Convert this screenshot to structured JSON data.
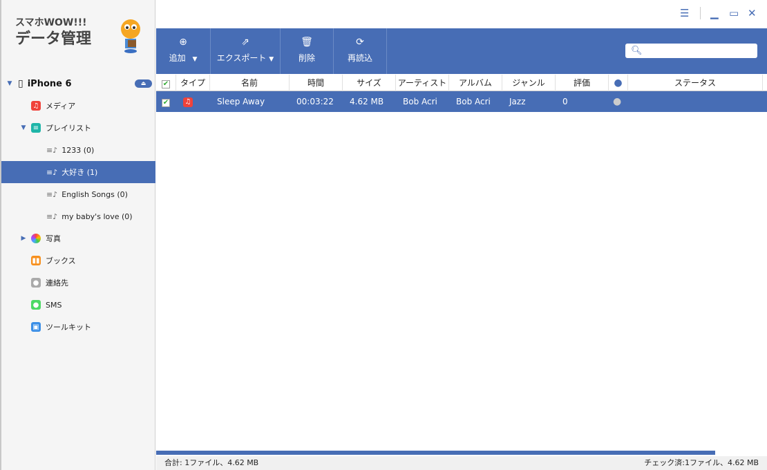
{
  "app": {
    "logo_line1": "スマホWOW!!!",
    "logo_line2": "データ管理"
  },
  "device": {
    "name": "iPhone 6"
  },
  "sidebar": {
    "items": [
      {
        "label": "メディア"
      },
      {
        "label": "プレイリスト"
      },
      {
        "label": "1233 (0)"
      },
      {
        "label": "大好き (1)"
      },
      {
        "label": "English Songs (0)"
      },
      {
        "label": "my baby's love (0)"
      },
      {
        "label": "写真"
      },
      {
        "label": "ブックス"
      },
      {
        "label": "連絡先"
      },
      {
        "label": "SMS"
      },
      {
        "label": "ツールキット"
      }
    ]
  },
  "toolbar": {
    "add": "追加",
    "export": "エクスポート",
    "delete": "削除",
    "reload": "再読込"
  },
  "table": {
    "headers": [
      "タイプ",
      "名前",
      "時間",
      "サイズ",
      "アーティスト",
      "アルバム",
      "ジャンル",
      "評価",
      "ステータス"
    ],
    "rows": [
      {
        "name": "Sleep Away",
        "time": "00:03:22",
        "size": "4.62 MB",
        "artist": "Bob Acri",
        "album": "Bob Acri",
        "genre": "Jazz",
        "rating": "0",
        "status": ""
      }
    ]
  },
  "status": {
    "total": "合計: 1ファイル、4.62 MB",
    "checked": "チェック済:1ファイル、4.62 MB"
  },
  "colors": {
    "accent": "#476db5"
  }
}
